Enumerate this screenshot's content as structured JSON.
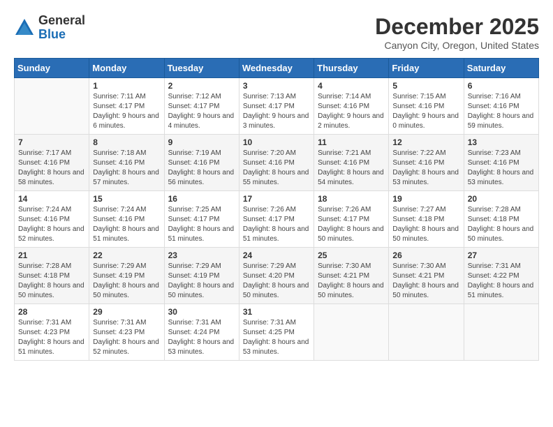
{
  "logo": {
    "general": "General",
    "blue": "Blue"
  },
  "header": {
    "month": "December 2025",
    "location": "Canyon City, Oregon, United States"
  },
  "weekdays": [
    "Sunday",
    "Monday",
    "Tuesday",
    "Wednesday",
    "Thursday",
    "Friday",
    "Saturday"
  ],
  "weeks": [
    [
      {
        "day": "",
        "sunrise": "",
        "sunset": "",
        "daylight": ""
      },
      {
        "day": "1",
        "sunrise": "7:11 AM",
        "sunset": "4:17 PM",
        "daylight": "9 hours and 6 minutes."
      },
      {
        "day": "2",
        "sunrise": "7:12 AM",
        "sunset": "4:17 PM",
        "daylight": "9 hours and 4 minutes."
      },
      {
        "day": "3",
        "sunrise": "7:13 AM",
        "sunset": "4:17 PM",
        "daylight": "9 hours and 3 minutes."
      },
      {
        "day": "4",
        "sunrise": "7:14 AM",
        "sunset": "4:16 PM",
        "daylight": "9 hours and 2 minutes."
      },
      {
        "day": "5",
        "sunrise": "7:15 AM",
        "sunset": "4:16 PM",
        "daylight": "9 hours and 0 minutes."
      },
      {
        "day": "6",
        "sunrise": "7:16 AM",
        "sunset": "4:16 PM",
        "daylight": "8 hours and 59 minutes."
      }
    ],
    [
      {
        "day": "7",
        "sunrise": "7:17 AM",
        "sunset": "4:16 PM",
        "daylight": "8 hours and 58 minutes."
      },
      {
        "day": "8",
        "sunrise": "7:18 AM",
        "sunset": "4:16 PM",
        "daylight": "8 hours and 57 minutes."
      },
      {
        "day": "9",
        "sunrise": "7:19 AM",
        "sunset": "4:16 PM",
        "daylight": "8 hours and 56 minutes."
      },
      {
        "day": "10",
        "sunrise": "7:20 AM",
        "sunset": "4:16 PM",
        "daylight": "8 hours and 55 minutes."
      },
      {
        "day": "11",
        "sunrise": "7:21 AM",
        "sunset": "4:16 PM",
        "daylight": "8 hours and 54 minutes."
      },
      {
        "day": "12",
        "sunrise": "7:22 AM",
        "sunset": "4:16 PM",
        "daylight": "8 hours and 53 minutes."
      },
      {
        "day": "13",
        "sunrise": "7:23 AM",
        "sunset": "4:16 PM",
        "daylight": "8 hours and 53 minutes."
      }
    ],
    [
      {
        "day": "14",
        "sunrise": "7:24 AM",
        "sunset": "4:16 PM",
        "daylight": "8 hours and 52 minutes."
      },
      {
        "day": "15",
        "sunrise": "7:24 AM",
        "sunset": "4:16 PM",
        "daylight": "8 hours and 51 minutes."
      },
      {
        "day": "16",
        "sunrise": "7:25 AM",
        "sunset": "4:17 PM",
        "daylight": "8 hours and 51 minutes."
      },
      {
        "day": "17",
        "sunrise": "7:26 AM",
        "sunset": "4:17 PM",
        "daylight": "8 hours and 51 minutes."
      },
      {
        "day": "18",
        "sunrise": "7:26 AM",
        "sunset": "4:17 PM",
        "daylight": "8 hours and 50 minutes."
      },
      {
        "day": "19",
        "sunrise": "7:27 AM",
        "sunset": "4:18 PM",
        "daylight": "8 hours and 50 minutes."
      },
      {
        "day": "20",
        "sunrise": "7:28 AM",
        "sunset": "4:18 PM",
        "daylight": "8 hours and 50 minutes."
      }
    ],
    [
      {
        "day": "21",
        "sunrise": "7:28 AM",
        "sunset": "4:18 PM",
        "daylight": "8 hours and 50 minutes."
      },
      {
        "day": "22",
        "sunrise": "7:29 AM",
        "sunset": "4:19 PM",
        "daylight": "8 hours and 50 minutes."
      },
      {
        "day": "23",
        "sunrise": "7:29 AM",
        "sunset": "4:19 PM",
        "daylight": "8 hours and 50 minutes."
      },
      {
        "day": "24",
        "sunrise": "7:29 AM",
        "sunset": "4:20 PM",
        "daylight": "8 hours and 50 minutes."
      },
      {
        "day": "25",
        "sunrise": "7:30 AM",
        "sunset": "4:21 PM",
        "daylight": "8 hours and 50 minutes."
      },
      {
        "day": "26",
        "sunrise": "7:30 AM",
        "sunset": "4:21 PM",
        "daylight": "8 hours and 50 minutes."
      },
      {
        "day": "27",
        "sunrise": "7:31 AM",
        "sunset": "4:22 PM",
        "daylight": "8 hours and 51 minutes."
      }
    ],
    [
      {
        "day": "28",
        "sunrise": "7:31 AM",
        "sunset": "4:23 PM",
        "daylight": "8 hours and 51 minutes."
      },
      {
        "day": "29",
        "sunrise": "7:31 AM",
        "sunset": "4:23 PM",
        "daylight": "8 hours and 52 minutes."
      },
      {
        "day": "30",
        "sunrise": "7:31 AM",
        "sunset": "4:24 PM",
        "daylight": "8 hours and 53 minutes."
      },
      {
        "day": "31",
        "sunrise": "7:31 AM",
        "sunset": "4:25 PM",
        "daylight": "8 hours and 53 minutes."
      },
      {
        "day": "",
        "sunrise": "",
        "sunset": "",
        "daylight": ""
      },
      {
        "day": "",
        "sunrise": "",
        "sunset": "",
        "daylight": ""
      },
      {
        "day": "",
        "sunrise": "",
        "sunset": "",
        "daylight": ""
      }
    ]
  ]
}
